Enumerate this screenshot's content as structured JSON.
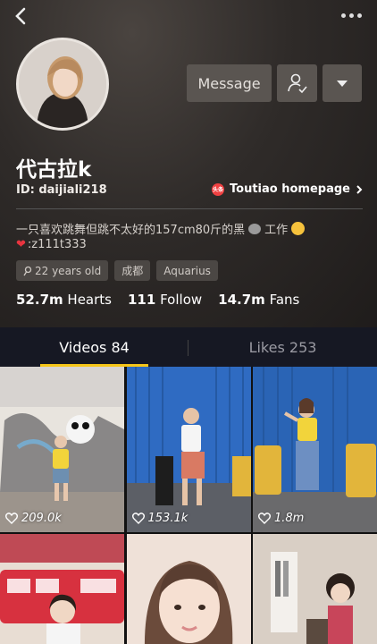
{
  "profile": {
    "name": "代古拉k",
    "id_label": "ID: daijiali218",
    "toutiao_label": "Toutiao homepage",
    "toutiao_logo_text": "头条",
    "bio_line1": "一只喜欢跳舞但跳不太好的157cm80斤的黑",
    "bio_line1_suffix": "工作",
    "bio_line2": ":z111t333",
    "tags": [
      "22 years old",
      "成都",
      "Aquarius"
    ],
    "stats": [
      {
        "value": "52.7m",
        "label": "Hearts"
      },
      {
        "value": "111",
        "label": "Follow"
      },
      {
        "value": "14.7m",
        "label": "Fans"
      }
    ]
  },
  "actions": {
    "message_label": "Message"
  },
  "tabs": [
    {
      "label": "Videos 84",
      "active": true
    },
    {
      "label": "Likes 253",
      "active": false
    }
  ],
  "videos": [
    {
      "likes": "209.0k"
    },
    {
      "likes": "153.1k"
    },
    {
      "likes": "1.8m"
    },
    {
      "likes": ""
    },
    {
      "likes": ""
    },
    {
      "likes": ""
    }
  ],
  "colors": {
    "accent": "#f5c518",
    "tab_bg": "#161823",
    "button_bg": "#5a5551"
  }
}
